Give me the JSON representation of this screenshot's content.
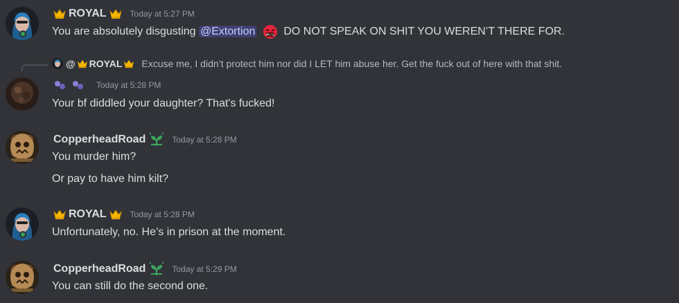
{
  "messages": [
    {
      "username": "ROYAL",
      "timestamp": "Today at 5:27 PM",
      "content_pre": "You are absolutely disgusting",
      "mention": "@Extortion",
      "content_post": "DO NOT SPEAK ON SHIT YOU WEREN’T THERE FOR.",
      "name_color": "#dbdee1"
    },
    {
      "reply_at": "@",
      "reply_username": "ROYAL",
      "reply_text": "Excuse me, I didn’t protect him nor did I LET him abuse her. Get the fuck out of here with that shit.",
      "timestamp": "Today at 5:28 PM",
      "content": "Your bf diddled your daughter? That's fucked!"
    },
    {
      "username": "CopperheadRoad",
      "timestamp": "Today at 5:28 PM",
      "lines": [
        "You murder him?",
        "Or pay to have him kilt?"
      ]
    },
    {
      "username": "ROYAL",
      "timestamp": "Today at 5:28 PM",
      "content": "Unfortunately, no. He’s in prison at the moment."
    },
    {
      "username": "CopperheadRoad",
      "timestamp": "Today at 5:29 PM",
      "content": "You can still do the second one."
    }
  ],
  "colors": {
    "background": "#313338",
    "mention_bg": "#3c4270",
    "timestamp": "#949ba4",
    "badge_green": "#3ba55c"
  },
  "icons": [
    "crown-icon",
    "angry-emoji-icon",
    "sprout-badge-icon",
    "anon-blob-icon"
  ]
}
